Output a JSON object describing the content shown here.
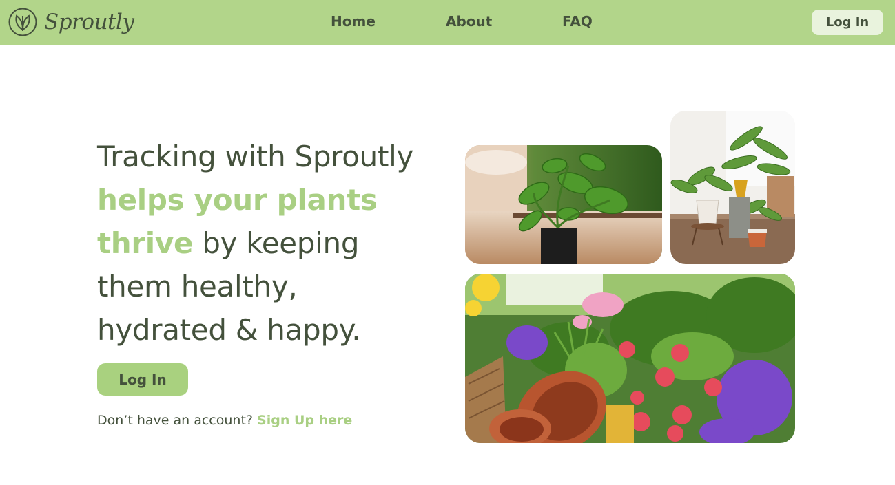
{
  "brand": {
    "name": "Sproutly"
  },
  "nav": {
    "home": "Home",
    "about": "About",
    "faq": "FAQ",
    "login": "Log In"
  },
  "hero": {
    "line1": "Tracking with Sproutly",
    "highlight1": "helps your plants",
    "highlight2": "thrive",
    "after_highlight": " by keeping",
    "line4": "them healthy,",
    "line5": "hydrated & happy."
  },
  "cta": {
    "login": "Log In",
    "no_account": "Don’t have an account? ",
    "signup": "Sign Up here"
  },
  "colors": {
    "navbar": "#b2d58a",
    "accent": "#a9cf83",
    "text": "#44513c",
    "nav_button": "#e9f3dd"
  },
  "images": [
    {
      "name": "pothos-plant-photo"
    },
    {
      "name": "indoor-plants-photo"
    },
    {
      "name": "flowers-and-pots-photo"
    }
  ]
}
